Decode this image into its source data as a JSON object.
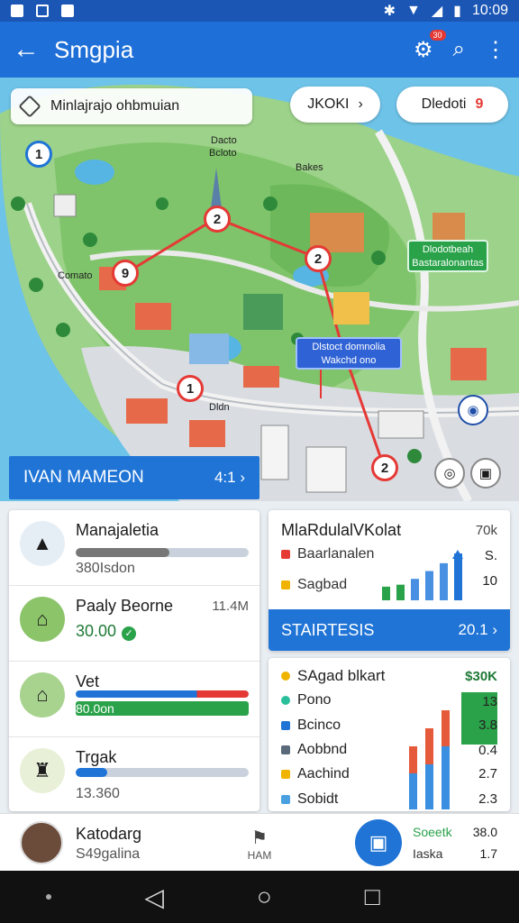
{
  "status": {
    "time": "10:09"
  },
  "appbar": {
    "title": "Smgpia",
    "badge": "30"
  },
  "map": {
    "search_text": "Minlajrajo ohbmuian",
    "pill1": "JKOKI",
    "pill2": "Dledoti",
    "pill2_num": "9",
    "labels": {
      "l1": "Dacto",
      "l2": "Bcloto",
      "l3": "Bakes",
      "l4": "Comato",
      "l5": "Dldn"
    },
    "markers": [
      "1",
      "2",
      "2",
      "9",
      "1",
      "2"
    ],
    "blue_tag_l1": "Dlstoct domnolia",
    "blue_tag_l2": "Wakchd ono",
    "green_tag_l1": "Dlodotbeah",
    "green_tag_l2": "Bastaralonantas",
    "banner_label": "IVAN MAMEON",
    "banner_value": "4:1 ›"
  },
  "leftcard": {
    "rows": [
      {
        "name": "Manajaletia",
        "sub": "380Isdon",
        "progress": 0.54
      },
      {
        "name": "Paaly Beorne",
        "sub": "30.00",
        "right": "11.4M"
      },
      {
        "name": "Vet",
        "sub": "80.0on",
        "progress": 1.0
      },
      {
        "name": "Trgak",
        "sub": "13.360",
        "progress": 0.18
      }
    ]
  },
  "rcard1": {
    "title": "MlaRdulalVKolat",
    "title_value": "70k",
    "leg1": "Baarlanalen",
    "leg1_val": "S.",
    "leg2": "Sagbad",
    "leg2_val": "10",
    "stat_label": "STAIRTESIS",
    "stat_value": "20.1 ›",
    "bars": [
      14,
      16,
      22,
      30,
      38,
      48
    ]
  },
  "rcard2": {
    "header": "SAgad blkart",
    "header_value": "$30K",
    "rows": [
      {
        "label": "Pono",
        "value": "13"
      },
      {
        "label": "Bcinco",
        "value": "3.8"
      },
      {
        "label": "Aobbnd",
        "value": "0.4"
      },
      {
        "label": "Aachind",
        "value": "2.7"
      },
      {
        "label": "Sobidt",
        "value": "2.3"
      }
    ],
    "bars": [
      {
        "blue": 40,
        "red": 30
      },
      {
        "blue": 50,
        "red": 40
      },
      {
        "blue": 70,
        "red": 50
      }
    ]
  },
  "profile": {
    "name": "Katodarg",
    "sub": "S49galina",
    "mid_label": "HAM",
    "g1": "Soeetk",
    "v1": "38.0",
    "g2": "Iaska",
    "v2": "1.7"
  },
  "colors": {
    "primary": "#1f74d6",
    "accent_red": "#e53935",
    "green": "#2aa24a"
  }
}
